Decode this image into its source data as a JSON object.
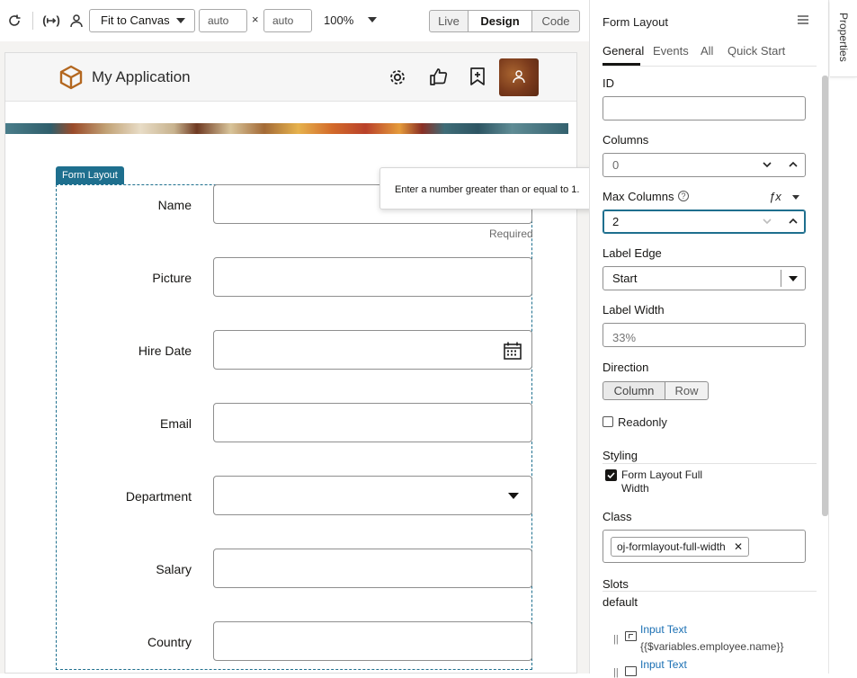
{
  "toolbar": {
    "refresh_icon": "refresh-icon",
    "variables_icon": "variables-icon",
    "user_icon": "user-icon",
    "fit_select": "Fit to Canvas",
    "width_value": "auto",
    "times_symbol": "×",
    "height_value": "auto",
    "zoom": "100%",
    "modes": [
      "Live",
      "Design",
      "Code"
    ],
    "active_mode": "Design"
  },
  "app": {
    "title": "My Application",
    "header_icons": [
      "gear-icon",
      "thumbs-up-icon",
      "bookmark-add-icon",
      "avatar"
    ]
  },
  "form": {
    "badge": "Form Layout",
    "tooltip": "Enter a number greater than or equal to 1.",
    "required_hint": "Required",
    "fields": [
      {
        "label": "Name",
        "type": "text"
      },
      {
        "label": "Picture",
        "type": "text"
      },
      {
        "label": "Hire Date",
        "type": "date"
      },
      {
        "label": "Email",
        "type": "text"
      },
      {
        "label": "Department",
        "type": "select"
      },
      {
        "label": "Salary",
        "type": "text"
      },
      {
        "label": "Country",
        "type": "text"
      }
    ]
  },
  "panel": {
    "title": "Form Layout",
    "tabs": [
      "General",
      "Events",
      "All",
      "Quick Start"
    ],
    "active_tab": "General",
    "id_label": "ID",
    "id_value": "",
    "columns_label": "Columns",
    "columns_value": "0",
    "max_columns_label": "Max Columns",
    "max_columns_value": "2",
    "fx_symbol": "ƒx",
    "label_edge_label": "Label Edge",
    "label_edge_value": "Start",
    "label_width_label": "Label Width",
    "label_width_placeholder": "33%",
    "direction_label": "Direction",
    "direction_options": [
      "Column",
      "Row"
    ],
    "readonly_label": "Readonly",
    "readonly_checked": false,
    "styling_label": "Styling",
    "full_width_label_line1": "Form Layout Full",
    "full_width_label_line2": "Width",
    "full_width_checked": true,
    "class_label": "Class",
    "class_chip": "oj-formlayout-full-width",
    "slots_label": "Slots",
    "default_label": "default",
    "slot_items": [
      {
        "name": "Input Text",
        "binding": "{{$variables.employee.name}}"
      },
      {
        "name": "Input Text",
        "binding": ""
      }
    ],
    "rail_label": "Properties"
  },
  "colors": {
    "badge": "#1e6f8e",
    "accent_link": "#1a6fb3",
    "app_icon": "#b3671f",
    "avatar_bg": "#8a4a25"
  }
}
